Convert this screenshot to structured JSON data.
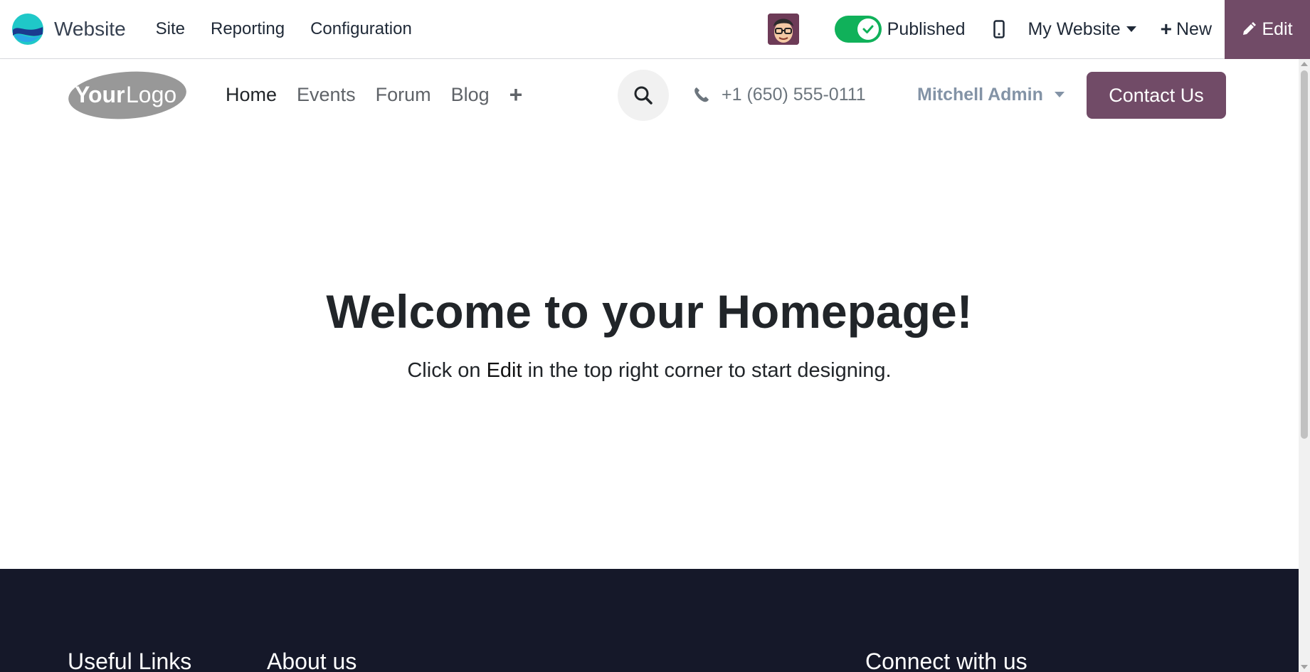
{
  "odoo_navbar": {
    "app_name": "Website",
    "menu": [
      "Site",
      "Reporting",
      "Configuration"
    ],
    "publish_toggle": {
      "label": "Published",
      "state": true
    },
    "website_selector": "My Website",
    "new_label": "New",
    "edit_label": "Edit",
    "colors": {
      "accent": "#714b67",
      "toggle_on": "#10b15a"
    }
  },
  "site_header": {
    "logo_text_bold": "Your",
    "logo_text_light": "Logo",
    "nav": [
      "Home",
      "Events",
      "Forum",
      "Blog"
    ],
    "active_nav": "Home",
    "phone": "+1 (650) 555-0111",
    "user": "Mitchell Admin",
    "contact_button": "Contact Us"
  },
  "hero": {
    "title_part1": "Welcome to your ",
    "title_bold": "Homepage",
    "title_part2": "!",
    "subtitle_part1": "Click on ",
    "subtitle_bold": "Edit",
    "subtitle_part2": " in the top right corner to start designing."
  },
  "footer": {
    "headings": [
      "Useful Links",
      "About us",
      "Connect with us"
    ],
    "background": "#151829"
  }
}
